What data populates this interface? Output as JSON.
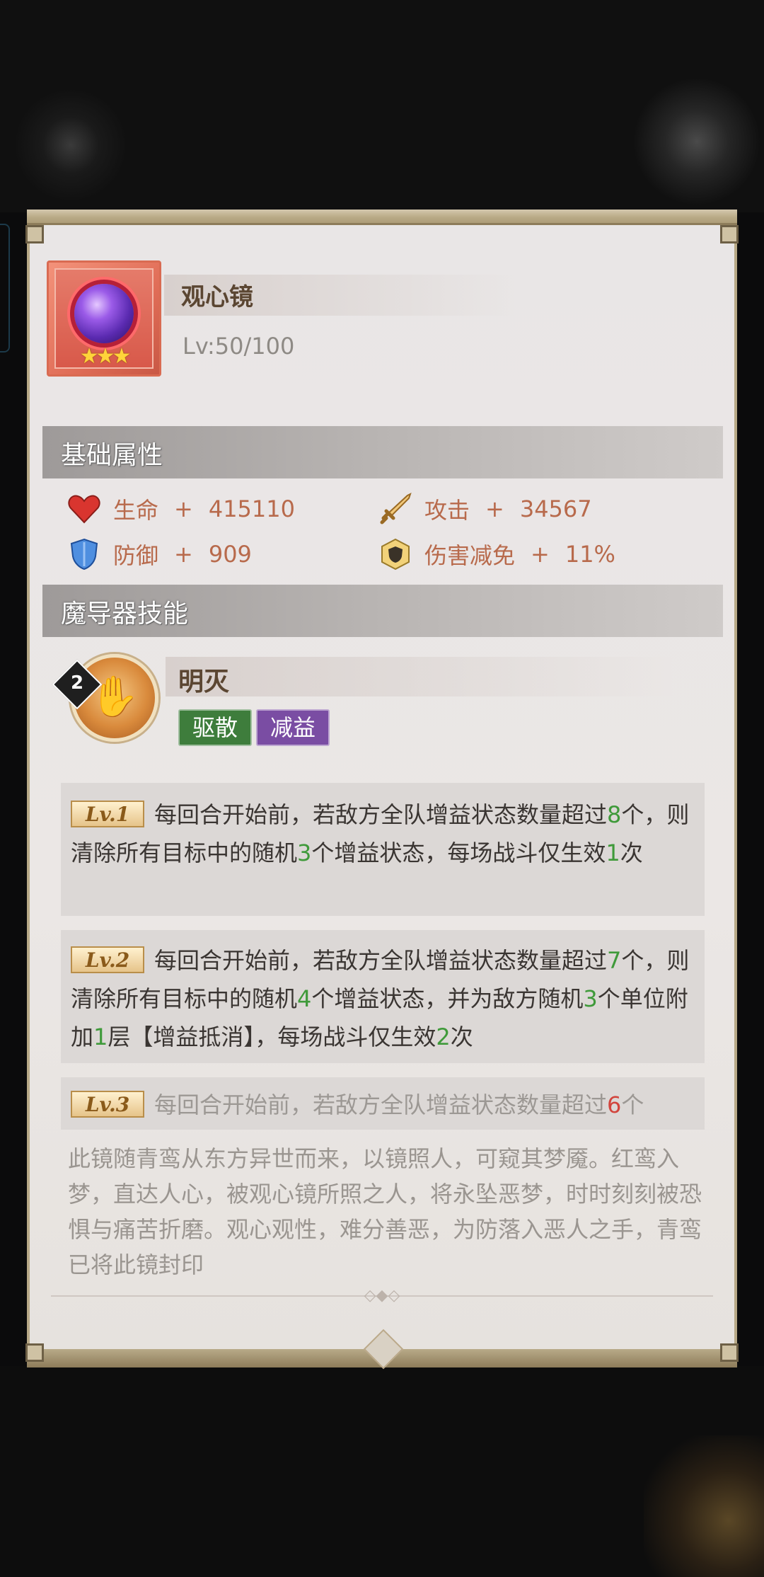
{
  "item": {
    "name": "观心镜",
    "level": "Lv:50/100",
    "stars": "★★★"
  },
  "sections": {
    "base_attributes": "基础属性",
    "skill": "魔导器技能"
  },
  "stats": [
    {
      "icon": "heart-icon",
      "label": "生命",
      "sign": "+",
      "value": "415110"
    },
    {
      "icon": "sword-icon",
      "label": "攻击",
      "sign": "+",
      "value": "34567"
    },
    {
      "icon": "shield-icon",
      "label": "防御",
      "sign": "+",
      "value": "909"
    },
    {
      "icon": "damage-reduction-icon",
      "label": "伤害减免",
      "sign": "+",
      "value": "11%"
    }
  ],
  "skill": {
    "badge": "2",
    "name": "明灭",
    "tags": [
      "驱散",
      "减益"
    ]
  },
  "levels": [
    {
      "badge": "Lv.1",
      "parts": [
        "每回合开始前，若敌方全队增益状态数量超过",
        "8",
        "个，则清除所有目标中的随机",
        "3",
        "个增益状态，每场战斗仅生效",
        "1",
        "次"
      ]
    },
    {
      "badge": "Lv.2",
      "parts": [
        "每回合开始前，若敌方全队增益状态数量超过",
        "7",
        "个，则清除所有目标中的随机",
        "4",
        "个增益状态，并为敌方随机",
        "3",
        "个单位附加",
        "1",
        "层【增益抵消】，每场战斗仅生效",
        "2",
        "次"
      ]
    },
    {
      "badge": "Lv.3",
      "parts": [
        "每回合开始前，若敌方全队增益状态数量超过",
        "6",
        "个"
      ]
    }
  ],
  "lore": "此镜随青鸾从东方异世而来，以镜照人，可窥其梦魇。红鸾入梦，直达人心，被观心镜所照之人，将永坠恶梦，时时刻刻被恐惧与痛苦折磨。观心观性，难分善恶，为防落入恶人之手，青鸾已将此镜封印",
  "colors": {
    "highlight_green": "#3f9a3a",
    "highlight_red": "#d2453d",
    "stat_text": "#b86a4c",
    "tag_green": "#3e7d3c",
    "tag_purple": "#7a4da3"
  }
}
